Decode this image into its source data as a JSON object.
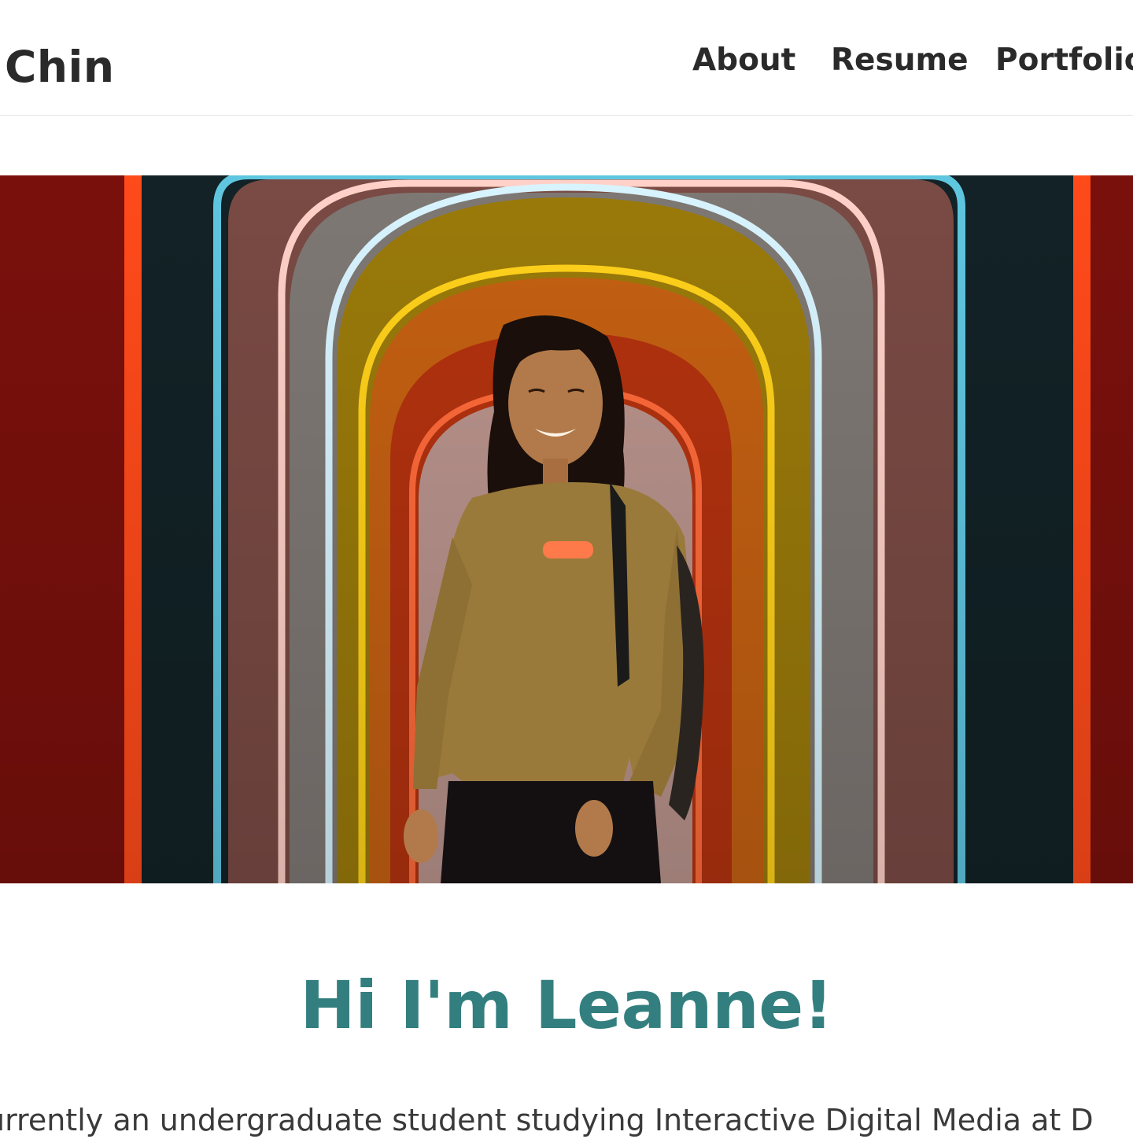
{
  "header": {
    "brand": "Chin",
    "nav": {
      "about": "About",
      "resume": "Resume",
      "portfolio": "Portfolio"
    }
  },
  "hero": {
    "alt": "photo-of-person-under-rainbow-arches"
  },
  "main": {
    "greeting": "Hi I'm Leanne!",
    "intro": "urrently an undergraduate student studying Interactive Digital Media at D"
  },
  "colors": {
    "greeting": "#337f7f",
    "text": "#2a2a2a",
    "header_border": "#e4e4e4"
  }
}
